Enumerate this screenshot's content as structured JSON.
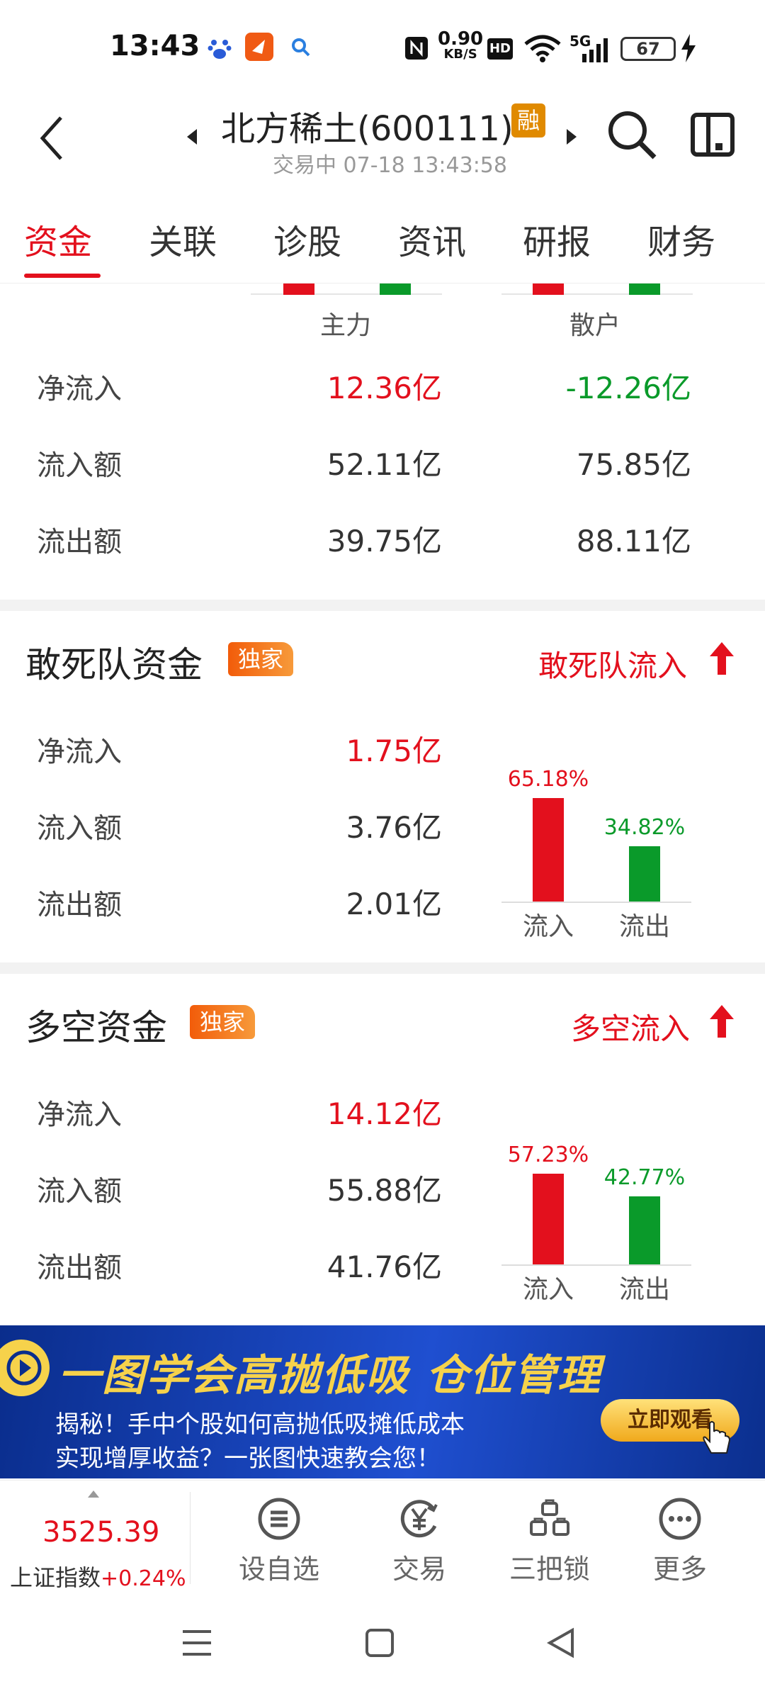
{
  "status_bar": {
    "time": "13:43",
    "net_speed_value": "0.90",
    "net_speed_unit": "KB/S",
    "hd": "HD",
    "signal": "5G",
    "battery": "67"
  },
  "header": {
    "stock_name": "北方稀土(600111)",
    "margin_badge": "融",
    "trade_status": "交易中 07-18  13:43:58"
  },
  "tabs": [
    {
      "label": "资金"
    },
    {
      "label": "关联"
    },
    {
      "label": "诊股"
    },
    {
      "label": "资讯"
    },
    {
      "label": "研报"
    },
    {
      "label": "财务"
    }
  ],
  "main_retail": {
    "columns": [
      "主力",
      "散户"
    ],
    "rows": [
      {
        "label": "净流入",
        "main": "12.36亿",
        "retail": "-12.26亿"
      },
      {
        "label": "流入额",
        "main": "52.11亿",
        "retail": "75.85亿"
      },
      {
        "label": "流出额",
        "main": "39.75亿",
        "retail": "88.11亿"
      }
    ]
  },
  "dare_squad": {
    "title": "敢死队资金",
    "badge": "独家",
    "flow_link": "敢死队流入",
    "rows": [
      {
        "label": "净流入",
        "value": "1.75亿"
      },
      {
        "label": "流入额",
        "value": "3.76亿"
      },
      {
        "label": "流出额",
        "value": "2.01亿"
      }
    ],
    "inflow_pct": "65.18%",
    "outflow_pct": "34.82%",
    "inflow_label": "流入",
    "outflow_label": "流出"
  },
  "long_short": {
    "title": "多空资金",
    "badge": "独家",
    "flow_link": "多空流入",
    "rows": [
      {
        "label": "净流入",
        "value": "14.12亿"
      },
      {
        "label": "流入额",
        "value": "55.88亿"
      },
      {
        "label": "流出额",
        "value": "41.76亿"
      }
    ],
    "inflow_pct": "57.23%",
    "outflow_pct": "42.77%",
    "inflow_label": "流入",
    "outflow_label": "流出"
  },
  "banner": {
    "title": "一图学会高抛低吸  仓位管理",
    "line1": "揭秘！手中个股如何高抛低吸摊低成本",
    "line2": "实现增厚收益？一张图快速教会您！",
    "button": "立即观看"
  },
  "toolbar": {
    "index_value": "3525.39",
    "index_name": "上证指数",
    "index_change": "+0.24%",
    "items": [
      {
        "label": "设自选",
        "icon": "list-icon"
      },
      {
        "label": "交易",
        "icon": "yen-icon"
      },
      {
        "label": "三把锁",
        "icon": "lock-icon"
      },
      {
        "label": "更多",
        "icon": "more-icon"
      }
    ]
  },
  "colors": {
    "accent_red": "#e3101d",
    "green": "#0a9a2a"
  }
}
